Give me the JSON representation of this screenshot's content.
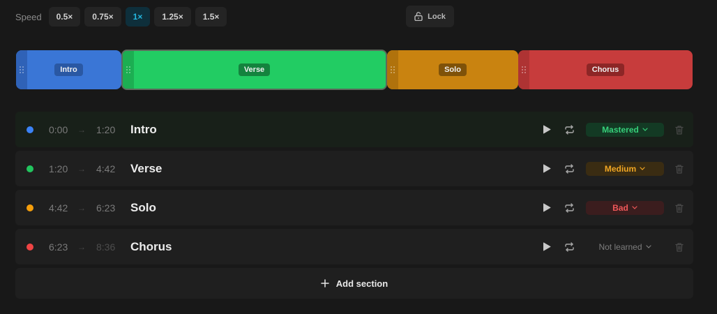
{
  "toolbar": {
    "speed_label": "Speed",
    "speeds": [
      {
        "label": "0.5×",
        "active": false
      },
      {
        "label": "0.75×",
        "active": false
      },
      {
        "label": "1×",
        "active": true
      },
      {
        "label": "1.25×",
        "active": false
      },
      {
        "label": "1.5×",
        "active": false
      }
    ],
    "lock_label": "Lock",
    "lock_icon": "lock-open-icon"
  },
  "timeline": {
    "segments": [
      {
        "label": "Intro",
        "color": "#3a76d6",
        "handle_color": "#2f62b7",
        "label_bg": "#2a58a3",
        "selected": false
      },
      {
        "label": "Verse",
        "color": "#22cc63",
        "handle_color": "#1cae52",
        "label_bg": "#14833e",
        "selected": true
      },
      {
        "label": "Solo",
        "color": "#c98310",
        "handle_color": "#b0720c",
        "label_bg": "#7f5209",
        "selected": false
      },
      {
        "label": "Chorus",
        "color": "#c73c3c",
        "handle_color": "#ae3333",
        "label_bg": "#8d2626",
        "selected": false
      }
    ]
  },
  "sections": [
    {
      "name": "Intro",
      "start": "0:00",
      "arrow": "→",
      "end": "1:20",
      "dot_color": "#3b82f6",
      "status": "Mastered",
      "status_color": "#36d07a",
      "status_bg": "#133a24",
      "active": true,
      "end_dim": false
    },
    {
      "name": "Verse",
      "start": "1:20",
      "arrow": "→",
      "end": "4:42",
      "dot_color": "#22c55e",
      "status": "Medium",
      "status_color": "#f0a623",
      "status_bg": "#3a2c12",
      "active": false,
      "end_dim": false
    },
    {
      "name": "Solo",
      "start": "4:42",
      "arrow": "→",
      "end": "6:23",
      "dot_color": "#f59e0b",
      "status": "Bad",
      "status_color": "#f0585a",
      "status_bg": "#3b1d1e",
      "active": false,
      "end_dim": false
    },
    {
      "name": "Chorus",
      "start": "6:23",
      "arrow": "→",
      "end": "8:36",
      "dot_color": "#ef4444",
      "status": "Not learned",
      "status_color": "#7d7d7d",
      "status_bg": "transparent",
      "active": false,
      "end_dim": true
    }
  ],
  "add_section_label": "Add section",
  "icons": {
    "play": "play-icon",
    "repeat": "repeat-icon",
    "delete": "trash-icon",
    "chevron": "chevron-down-icon",
    "grip": "grip-icon",
    "plus": "plus-icon"
  }
}
